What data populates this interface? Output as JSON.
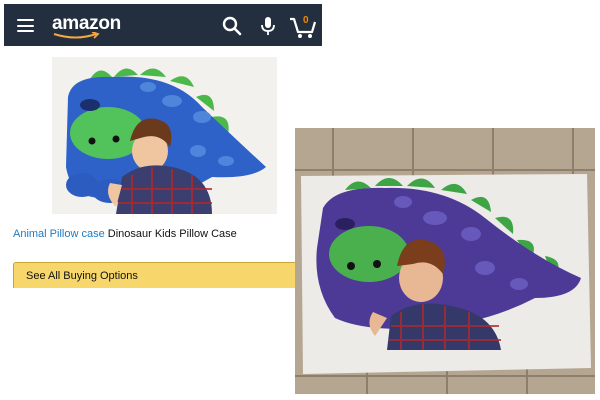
{
  "header": {
    "logo_text": "amazon",
    "icons": [
      "menu-icon",
      "search-icon",
      "microphone-icon",
      "cart-icon"
    ],
    "cart_count": "0",
    "background": "#232f3e"
  },
  "product": {
    "title_link": "Animal Pillow case",
    "title_rest": " Dinosaur Kids Pillow Case",
    "link_color": "#1f7ac2"
  },
  "buying_options": {
    "label": "See All Buying Options",
    "color": "#f7d76b"
  }
}
